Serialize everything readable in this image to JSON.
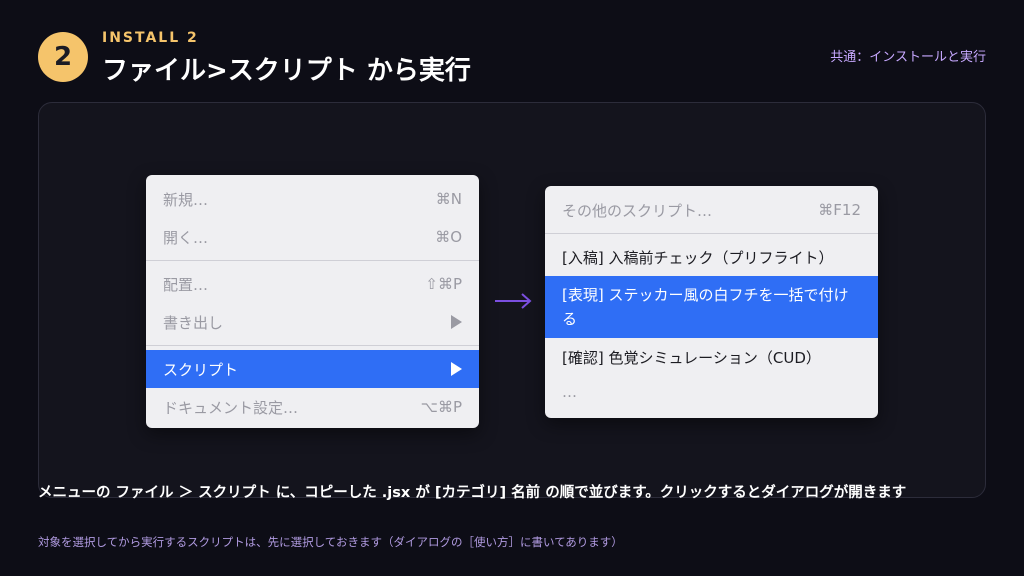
{
  "step": {
    "number": "2",
    "kicker": "INSTALL 2"
  },
  "title": "ファイル>スクリプト から実行",
  "section_label": "共通：インストールと実行",
  "file_menu": {
    "items": [
      {
        "label": "新規…",
        "shortcut": "⌘N",
        "state": "disabled"
      },
      {
        "label": "開く…",
        "shortcut": "⌘O",
        "state": "disabled"
      },
      {
        "label": "配置…",
        "shortcut": "⇧⌘P",
        "state": "disabled"
      },
      {
        "label": "書き出し",
        "shortcut": "",
        "state": "disabled",
        "submenu": true
      },
      {
        "label": "スクリプト",
        "shortcut": "",
        "state": "active",
        "submenu": true
      },
      {
        "label": "ドキュメント設定…",
        "shortcut": "⌥⌘P",
        "state": "disabled"
      }
    ]
  },
  "script_menu": {
    "header": {
      "label": "その他のスクリプト…",
      "shortcut": "⌘F12"
    },
    "items": [
      {
        "label": "[入稿] 入稿前チェック（プリフライト）",
        "state": "normal"
      },
      {
        "label": "[表現] ステッカー風の白フチを一括で付ける",
        "state": "active"
      },
      {
        "label": "[確認] 色覚シミュレーション（CUD）",
        "state": "normal"
      },
      {
        "label": "…",
        "state": "disabled"
      }
    ]
  },
  "caption": "メニューの ファイル ＞ スクリプト に、コピーした .jsx が [カテゴリ] 名前 の順で並びます。クリックするとダイアログが開きます",
  "subcaption": "対象を選択してから実行するスクリプトは、先に選択しておきます（ダイアログの［使い方］に書いてあります）",
  "colors": {
    "accent": "#f5c46b",
    "highlight": "#2f6ef5",
    "arrow": "#7b4fe0",
    "label": "#c7a8ff"
  }
}
